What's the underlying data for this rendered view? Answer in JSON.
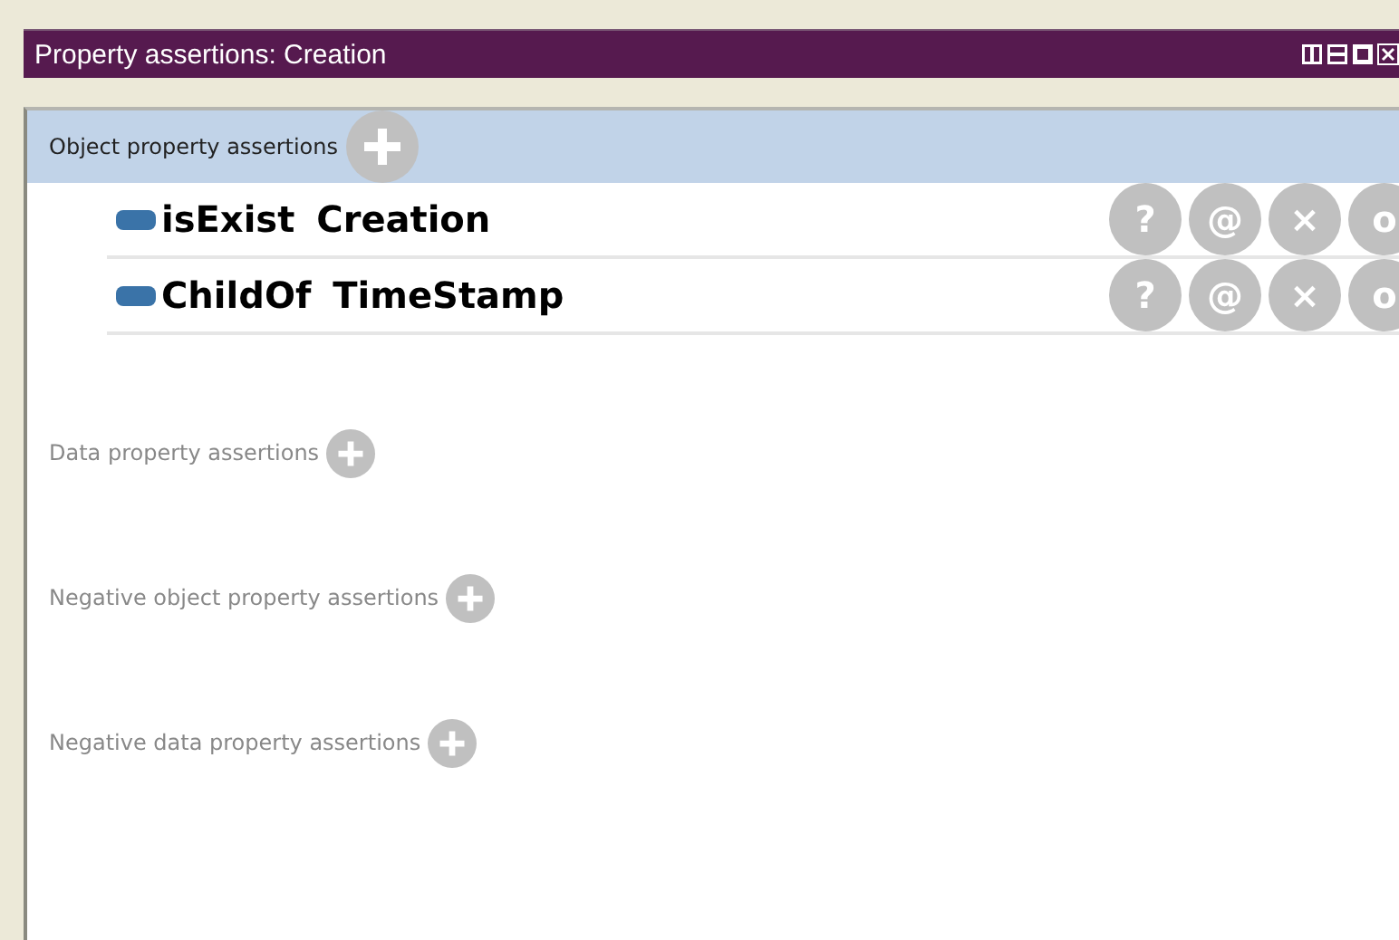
{
  "window": {
    "title": "Property assertions: Creation"
  },
  "sections": [
    {
      "label": "Object property assertions",
      "selected": true,
      "rows": [
        {
          "property": "isExist",
          "value": "Creation",
          "actions": [
            "?",
            "@",
            "×",
            "o"
          ]
        },
        {
          "property": "ChildOf",
          "value": "TimeStamp",
          "actions": [
            "?",
            "@",
            "×",
            "o"
          ]
        }
      ]
    },
    {
      "label": "Data property assertions",
      "selected": false
    },
    {
      "label": "Negative object property assertions",
      "selected": false
    },
    {
      "label": "Negative data property assertions",
      "selected": false
    }
  ]
}
